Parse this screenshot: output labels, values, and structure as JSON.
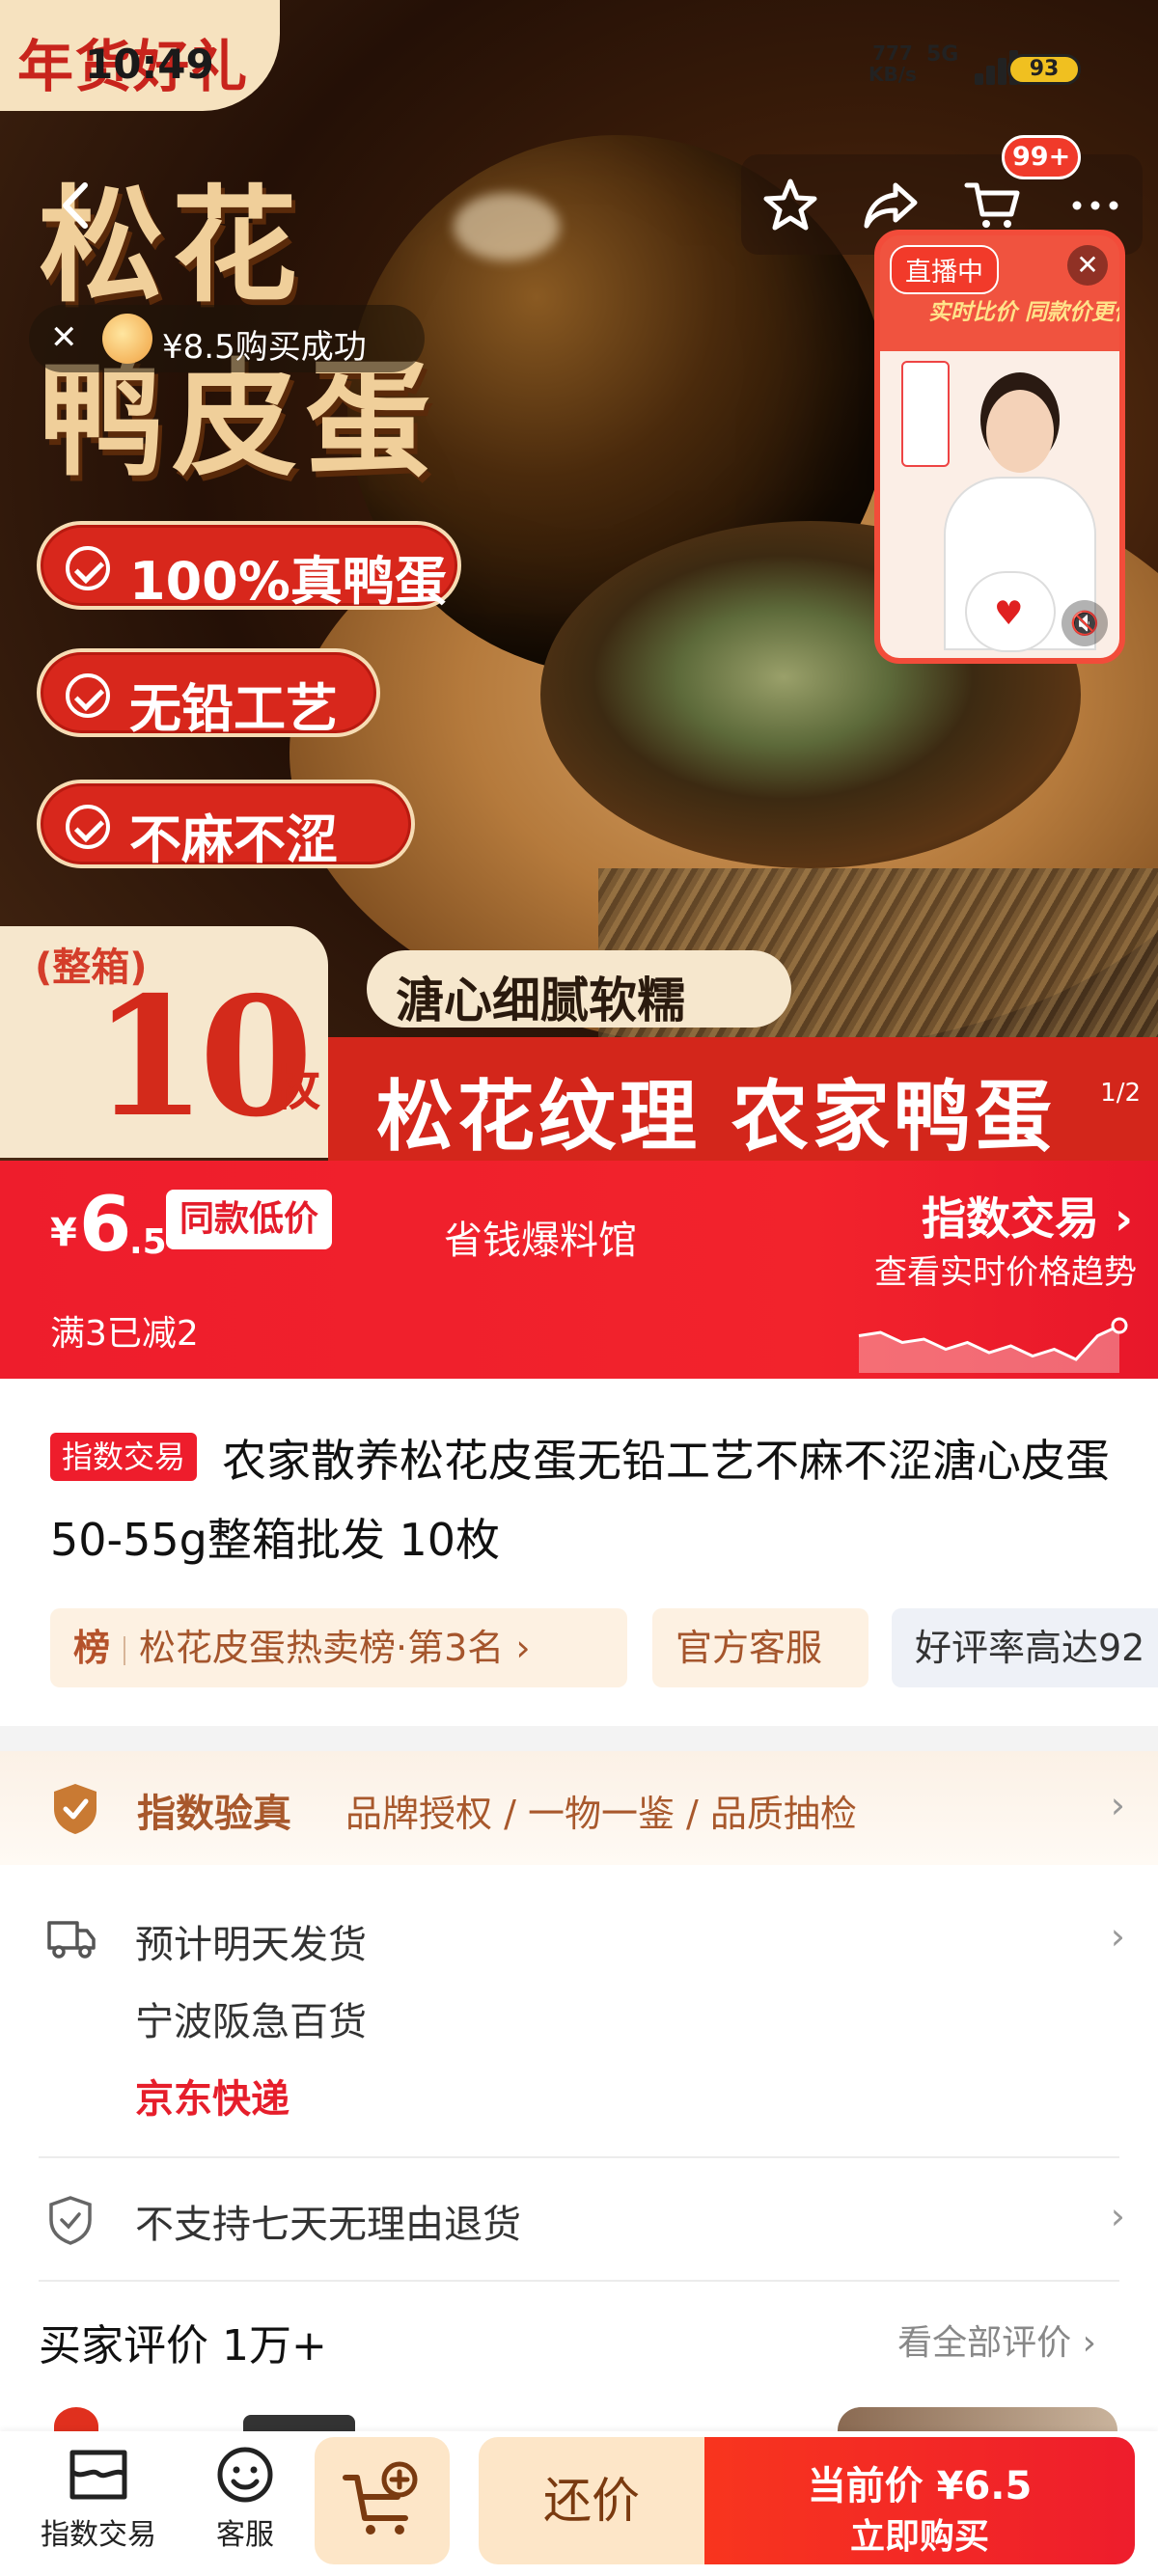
{
  "status_bar": {
    "time": "10:49",
    "net_speed": "777",
    "net_unit": "KB/s",
    "network": "5G",
    "battery": "93"
  },
  "hero": {
    "corner_banner": "年货好礼",
    "title_line1": "松花",
    "title_line2": "鸭皮蛋",
    "badges": [
      "100%真鸭蛋",
      "无铅工艺",
      "不麻不涩"
    ],
    "box_label": "(整箱)",
    "count": "10",
    "count_unit": "枚",
    "tagline": "溏心细腻软糯",
    "slogan": "松花纹理 农家鸭蛋",
    "image_index": "1",
    "image_total": "2",
    "cart_badge": "99+",
    "toast": "¥8.5购买成功",
    "live": {
      "tag": "直播中",
      "subtitle": "实时比价 同款价更低"
    }
  },
  "price_bar": {
    "currency": "¥",
    "price_int": "6",
    "price_dec": ".5",
    "low_badge": "同款低价",
    "shop": "省钱爆料馆",
    "promo": "满3已减2",
    "index_title": "指数交易",
    "index_sub": "查看实时价格趋势",
    "trend": [
      0.55,
      0.6,
      0.45,
      0.5,
      0.35,
      0.45,
      0.3,
      0.4,
      0.25,
      0.35,
      0.2,
      0.55,
      0.7
    ]
  },
  "product": {
    "tag": "指数交易",
    "title": "农家散养松花皮蛋无铅工艺不麻不涩溏心皮蛋50-55g整箱批发 10枚",
    "chips": {
      "rank_icon": "榜",
      "rank": "松花皮蛋热卖榜·第3名",
      "service": "官方客服",
      "rating": "好评率高达92"
    }
  },
  "service": {
    "verify_title": "指数验真",
    "verify_detail": "品牌授权 / 一物一鉴 / 品质抽检",
    "ship_time": "预计明天发货",
    "ship_from": "宁波阪急百货",
    "courier": "京东快递",
    "returns": "不支持七天无理由退货",
    "reviews_title": "买家评价 1万+",
    "reviews_all": "看全部评价"
  },
  "bottom_bar": {
    "tab1": "指数交易",
    "tab2": "客服",
    "haggle": "还价",
    "buy_price": "当前价 ¥6.5",
    "buy_label": "立即购买"
  },
  "colors": {
    "accent": "#ee1d2c",
    "gold": "#a8582c",
    "cream": "#fde6c8"
  }
}
